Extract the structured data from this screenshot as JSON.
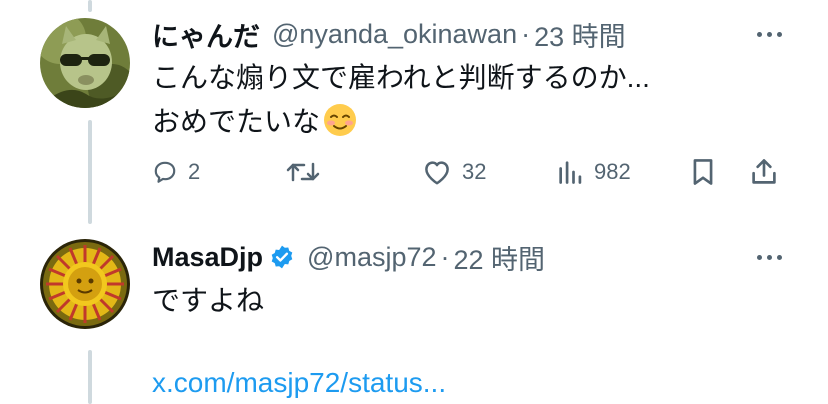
{
  "tweets": [
    {
      "display_name": "にゃんだ",
      "handle": "@nyanda_okinawan",
      "separator": "·",
      "time": "23 時間",
      "text_lines": [
        "こんな煽り文で雇われと判断するのか...",
        "おめでたいな"
      ],
      "emoji": "☺️",
      "avatar_icon": "cat-with-sunglasses-avatar",
      "actions": {
        "reply_count": "2",
        "retweet_count": "",
        "like_count": "32",
        "view_count": "982"
      }
    },
    {
      "display_name": "MasaDjp",
      "handle": "@masjp72",
      "separator": "·",
      "time": "22 時間",
      "verified": true,
      "text_lines": [
        "ですよね"
      ],
      "link": "x.com/masjp72/status...",
      "avatar_icon": "sun-avatar"
    }
  ],
  "colors": {
    "text": "#0f1419",
    "secondary": "#536471",
    "link": "#1d9bf0",
    "verified": "#1d9bf0",
    "thread_line": "#cfd9de"
  }
}
